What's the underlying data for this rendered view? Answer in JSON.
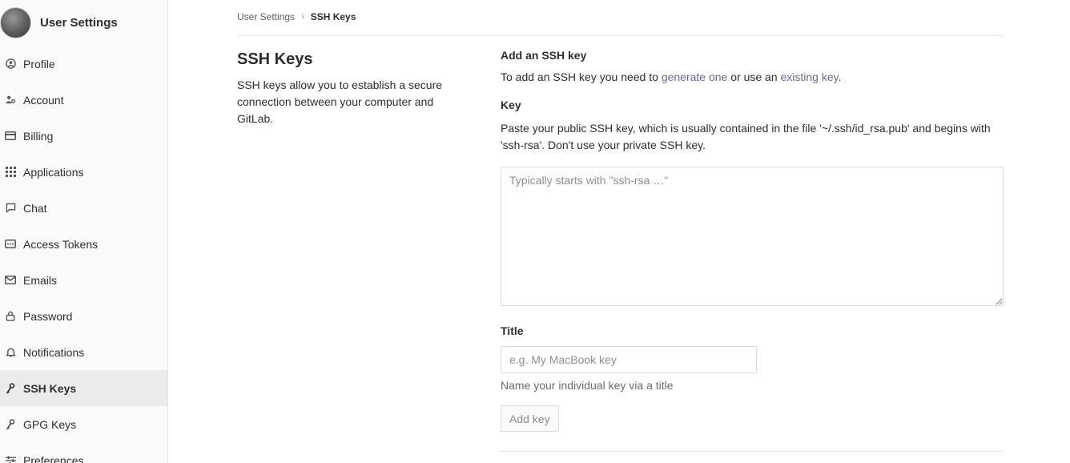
{
  "sidebar": {
    "title": "User Settings",
    "items": [
      {
        "label": "Profile",
        "icon": "profile-icon"
      },
      {
        "label": "Account",
        "icon": "account-icon"
      },
      {
        "label": "Billing",
        "icon": "billing-icon"
      },
      {
        "label": "Applications",
        "icon": "applications-icon"
      },
      {
        "label": "Chat",
        "icon": "chat-icon"
      },
      {
        "label": "Access Tokens",
        "icon": "access-tokens-icon"
      },
      {
        "label": "Emails",
        "icon": "emails-icon"
      },
      {
        "label": "Password",
        "icon": "password-icon"
      },
      {
        "label": "Notifications",
        "icon": "notifications-icon"
      },
      {
        "label": "SSH Keys",
        "icon": "ssh-key-icon",
        "active": true
      },
      {
        "label": "GPG Keys",
        "icon": "gpg-key-icon"
      },
      {
        "label": "Preferences",
        "icon": "preferences-icon"
      }
    ]
  },
  "breadcrumb": {
    "parent": "User Settings",
    "separator": "›",
    "current": "SSH Keys"
  },
  "page": {
    "title": "SSH Keys",
    "description": "SSH keys allow you to establish a secure connection between your computer and GitLab."
  },
  "form": {
    "section_title": "Add an SSH key",
    "intro_prefix": "To add an SSH key you need to ",
    "intro_link1": "generate one",
    "intro_middle": " or use an ",
    "intro_link2": "existing key",
    "intro_suffix": ".",
    "key_label": "Key",
    "key_help": "Paste your public SSH key, which is usually contained in the file '~/.ssh/id_rsa.pub' and begins with 'ssh-rsa'. Don't use your private SSH key.",
    "key_placeholder": "Typically starts with \"ssh-rsa …\"",
    "key_value": "",
    "title_label": "Title",
    "title_placeholder": "e.g. My MacBook key",
    "title_value": "",
    "title_help": "Name your individual key via a title",
    "submit_label": "Add key"
  },
  "colors": {
    "link": "#6a6a8a",
    "sidebar_bg": "#fafafa",
    "active_bg": "#ececec",
    "border": "#e5e5e5"
  }
}
